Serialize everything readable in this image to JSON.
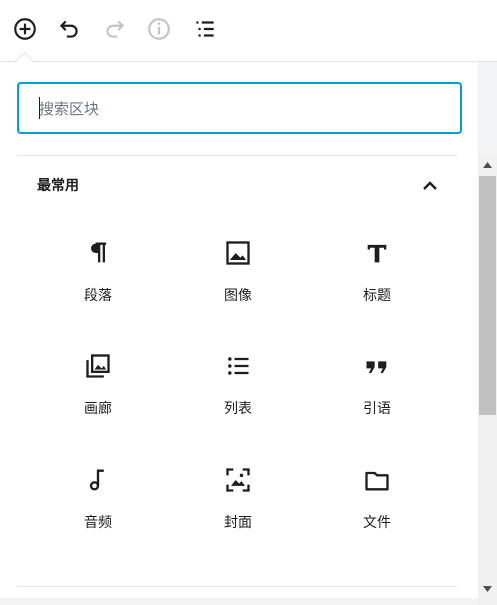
{
  "toolbar": {
    "buttons": [
      {
        "icon": "plus-circle-icon",
        "enabled": true
      },
      {
        "icon": "undo-icon",
        "enabled": true
      },
      {
        "icon": "redo-icon",
        "enabled": false
      },
      {
        "icon": "info-icon",
        "enabled": false
      },
      {
        "icon": "list-view-icon",
        "enabled": true
      }
    ]
  },
  "search": {
    "placeholder": "搜索区块",
    "value": ""
  },
  "category": {
    "title": "最常用",
    "expanded": true
  },
  "blocks": [
    {
      "label": "段落",
      "icon": "paragraph-icon"
    },
    {
      "label": "图像",
      "icon": "image-icon"
    },
    {
      "label": "标题",
      "icon": "heading-icon"
    },
    {
      "label": "画廊",
      "icon": "gallery-icon"
    },
    {
      "label": "列表",
      "icon": "list-icon"
    },
    {
      "label": "引语",
      "icon": "quote-icon"
    },
    {
      "label": "音频",
      "icon": "audio-icon"
    },
    {
      "label": "封面",
      "icon": "cover-icon"
    },
    {
      "label": "文件",
      "icon": "file-icon"
    }
  ],
  "colors": {
    "accent": "#00a0d2",
    "icon": "#1e1e1e",
    "disabled": "#c3c4c7",
    "divider": "#e2e4e7"
  }
}
